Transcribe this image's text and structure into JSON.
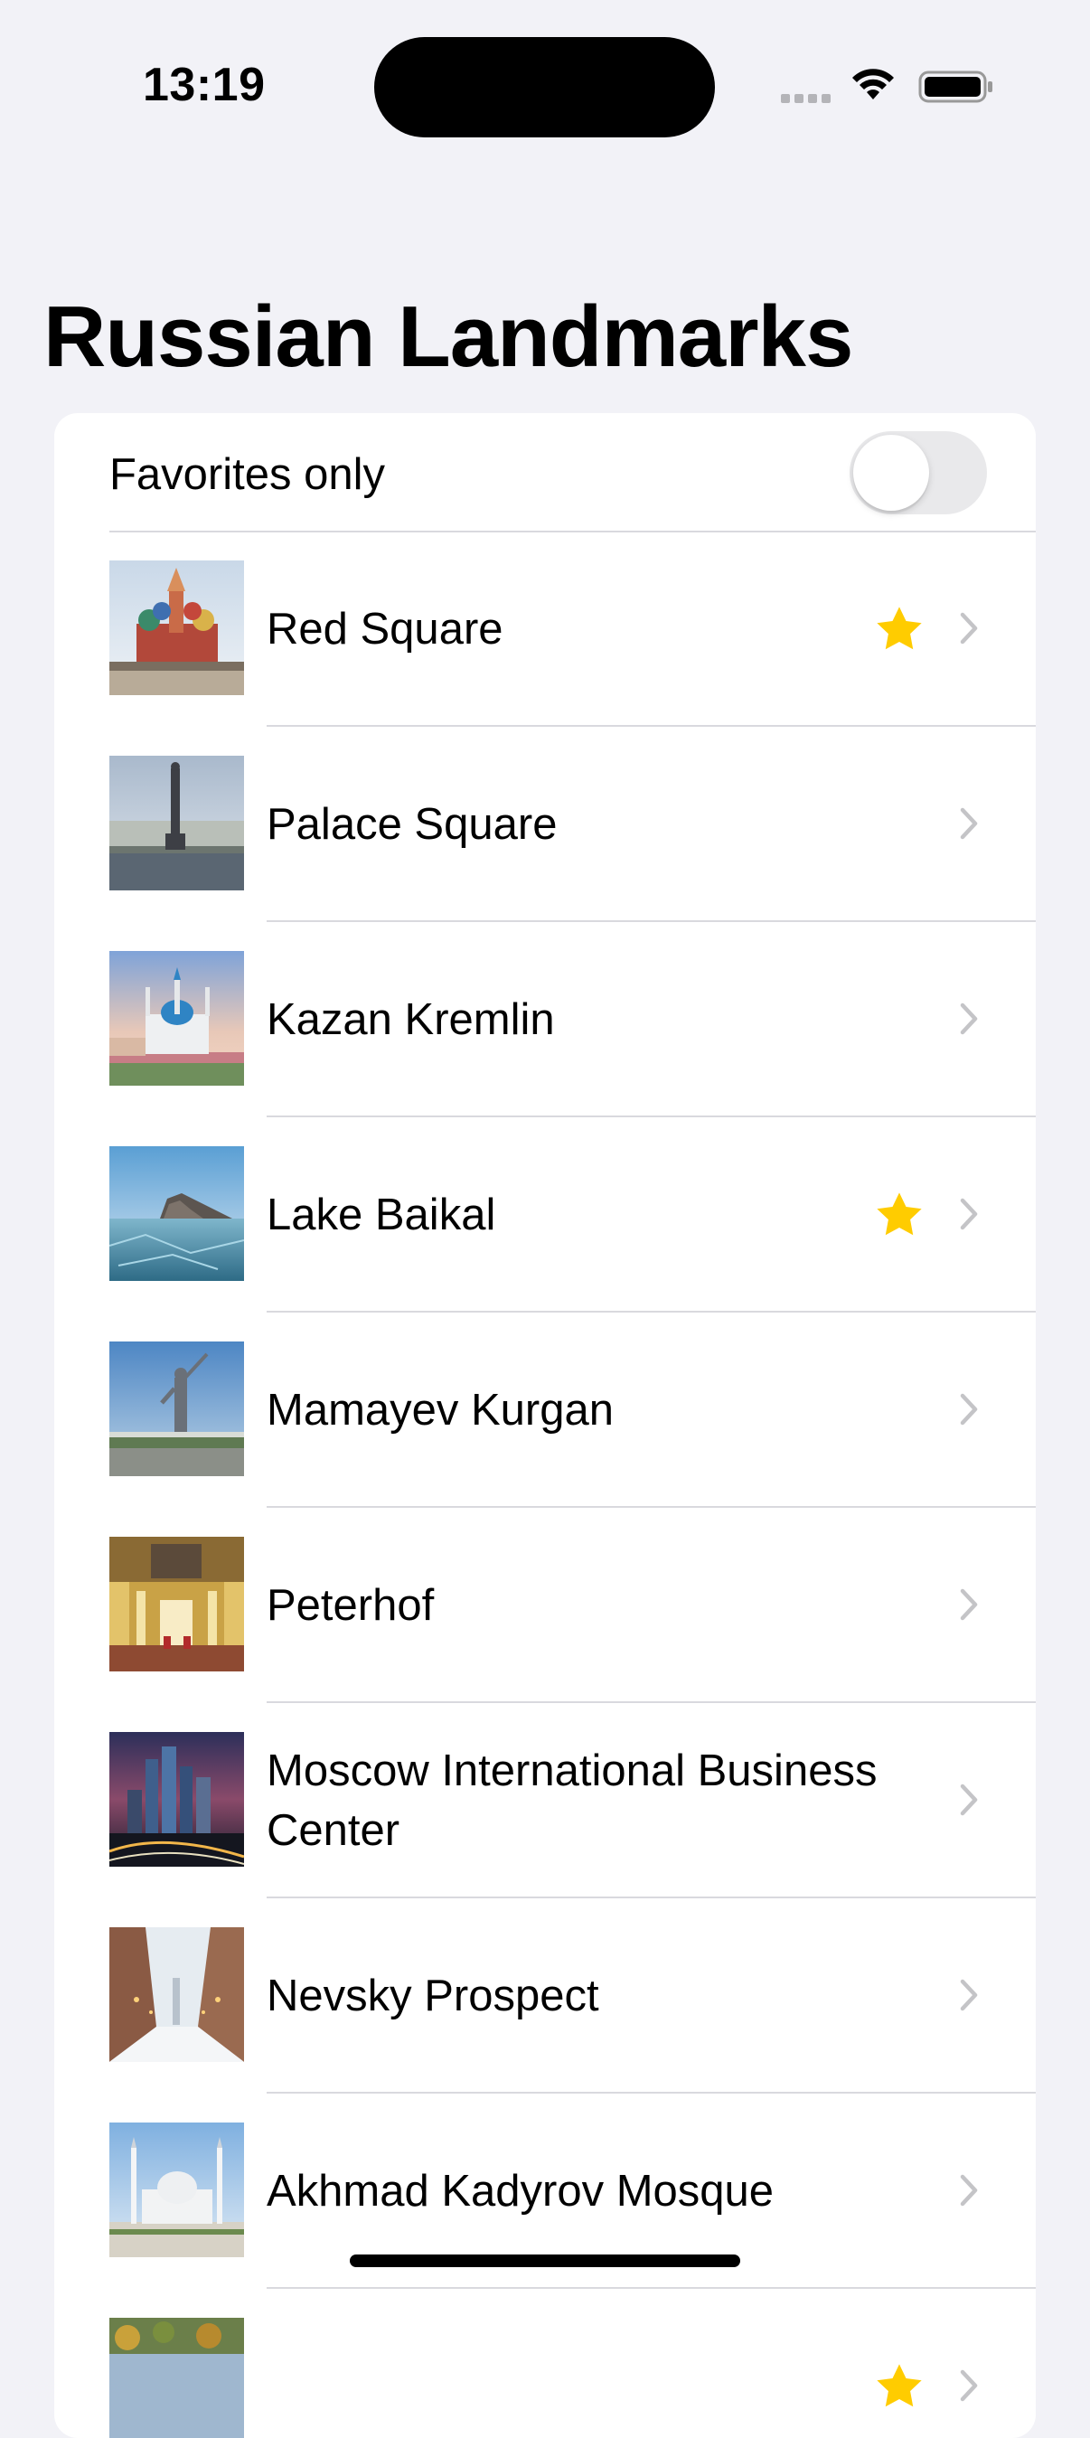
{
  "status_bar": {
    "time": "13:19"
  },
  "page": {
    "title": "Russian Landmarks"
  },
  "filter": {
    "label": "Favorites only",
    "enabled": false
  },
  "colors": {
    "favorite_star": "#ffcc00",
    "chevron": "#c4c4c7",
    "separator": "#d9d9de",
    "background": "#f2f2f7"
  },
  "landmarks": [
    {
      "name": "Red Square",
      "favorite": true
    },
    {
      "name": "Palace Square",
      "favorite": false
    },
    {
      "name": "Kazan Kremlin",
      "favorite": false
    },
    {
      "name": "Lake Baikal",
      "favorite": true
    },
    {
      "name": "Mamayev Kurgan",
      "favorite": false
    },
    {
      "name": "Peterhof",
      "favorite": false
    },
    {
      "name": "Moscow International Business Center",
      "favorite": false
    },
    {
      "name": "Nevsky Prospect",
      "favorite": false
    },
    {
      "name": "Akhmad Kadyrov Mosque",
      "favorite": false
    },
    {
      "name": "",
      "favorite": true
    }
  ]
}
